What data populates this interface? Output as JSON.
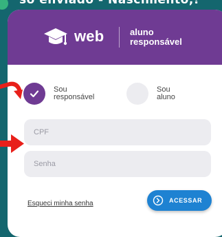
{
  "caption_top": "so enviado - Nascimento,!",
  "logo": {
    "brand": "web",
    "subtitle_line1": "aluno",
    "subtitle_line2": "responsável",
    "icon": "graduation-cap-icon"
  },
  "role_selector": {
    "options": [
      {
        "line1": "Sou",
        "line2": "responsável",
        "selected": true
      },
      {
        "line1": "Sou",
        "line2": "aluno",
        "selected": false
      }
    ]
  },
  "form": {
    "cpf_placeholder": "CPF",
    "cpf_value": "",
    "senha_placeholder": "Senha",
    "senha_value": "",
    "forgot_password": "Esqueci minha senha",
    "submit_label": "ACESSAR",
    "submit_icon": "chevron-right-circle-icon"
  },
  "colors": {
    "background": "#14666e",
    "header_purple": "#6f3b93",
    "button_blue": "#1e82d2",
    "field_bg": "#ececf0",
    "annotation_red": "#e8201a"
  }
}
